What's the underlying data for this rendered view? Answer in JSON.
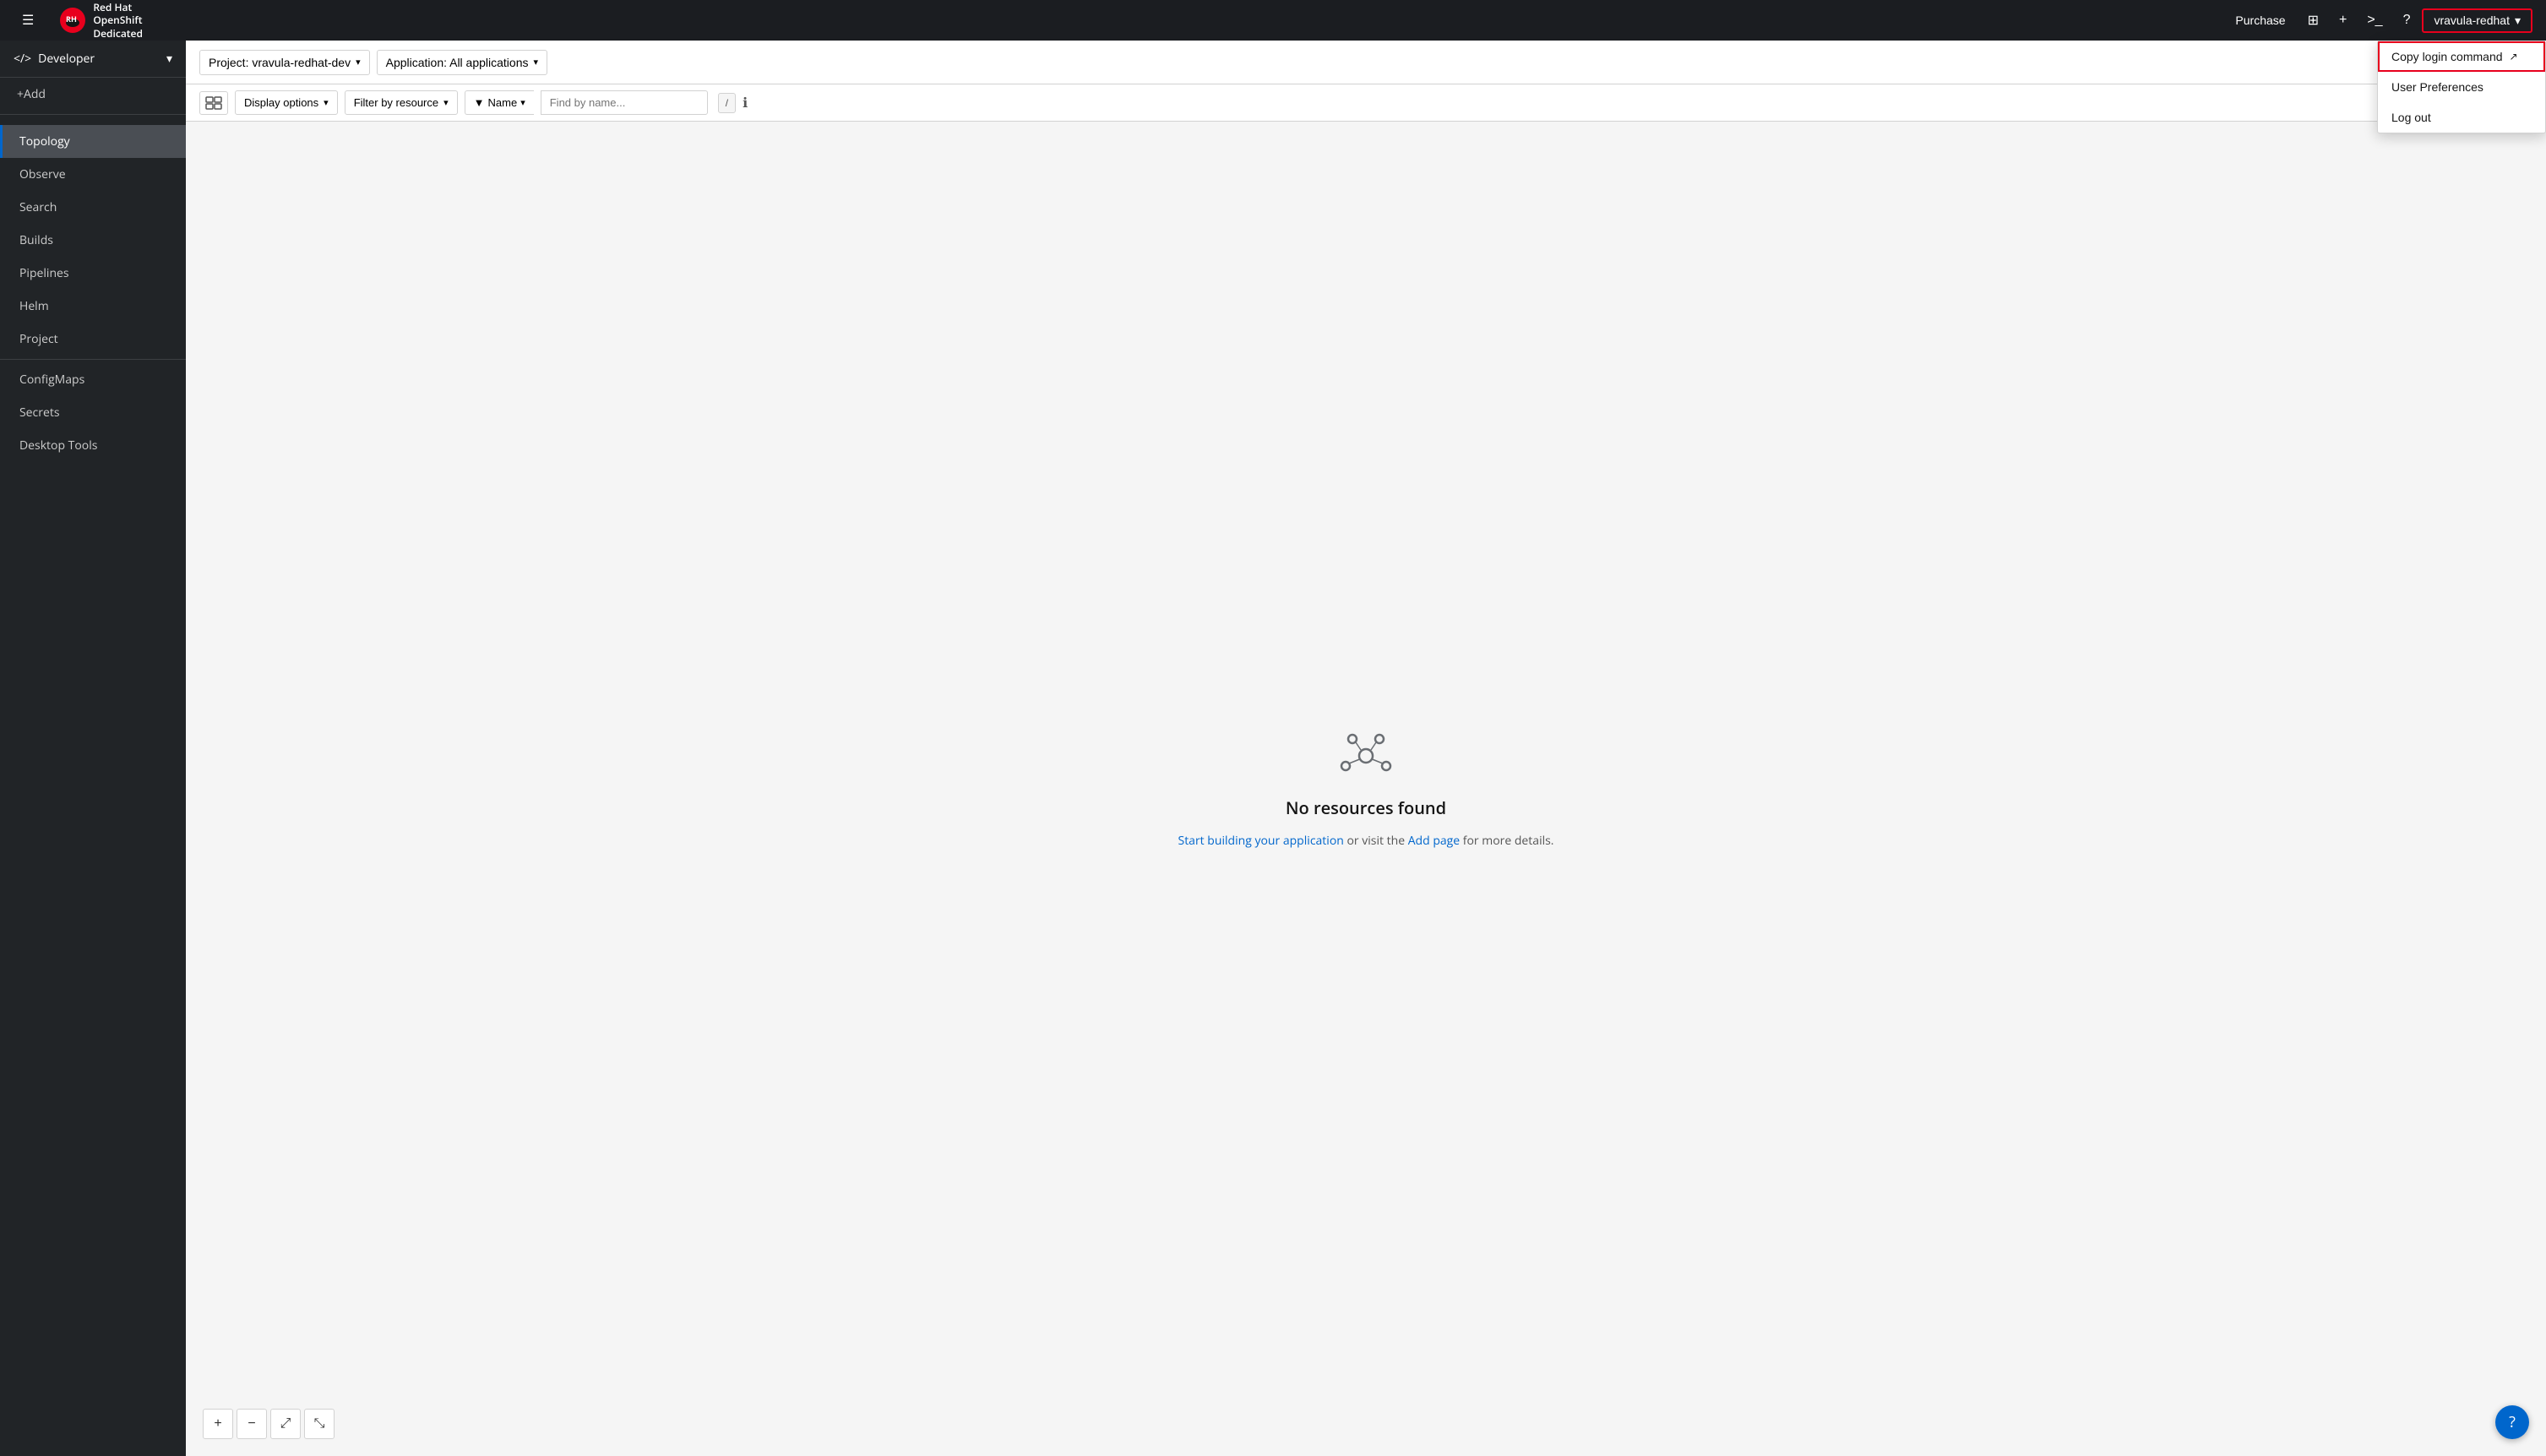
{
  "navbar": {
    "hamburger_label": "☰",
    "brand_line1": "Red Hat",
    "brand_line2": "OpenShift",
    "brand_line3": "Dedicated",
    "purchase_label": "Purchase",
    "grid_icon": "⊞",
    "plus_icon": "+",
    "terminal_icon": ">_",
    "help_icon": "?",
    "user_label": "vravula-redhat",
    "user_chevron": "▾"
  },
  "user_dropdown": {
    "copy_login_label": "Copy login command",
    "copy_login_icon": "↗",
    "user_preferences_label": "User Preferences",
    "logout_label": "Log out"
  },
  "sidebar": {
    "role_label": "Developer",
    "role_chevron": "▾",
    "add_label": "+Add",
    "items": [
      {
        "id": "topology",
        "label": "Topology",
        "active": true
      },
      {
        "id": "observe",
        "label": "Observe"
      },
      {
        "id": "search",
        "label": "Search"
      },
      {
        "id": "builds",
        "label": "Builds"
      },
      {
        "id": "pipelines",
        "label": "Pipelines"
      },
      {
        "id": "helm",
        "label": "Helm"
      },
      {
        "id": "project",
        "label": "Project"
      },
      {
        "id": "configmaps",
        "label": "ConfigMaps"
      },
      {
        "id": "secrets",
        "label": "Secrets"
      },
      {
        "id": "desktop-tools",
        "label": "Desktop Tools"
      }
    ]
  },
  "toolbar": {
    "project_label": "Project: vravula-redhat-dev",
    "project_chevron": "▾",
    "app_label": "Application: All applications",
    "app_chevron": "▾",
    "help_icon": "?",
    "view_icon": "W"
  },
  "filter_toolbar": {
    "view_toggle_icon": "📋",
    "display_options_label": "Display options",
    "display_options_chevron": "▾",
    "filter_resource_label": "Filter by resource",
    "filter_resource_chevron": "▾",
    "filter_icon": "▼",
    "name_label": "Name",
    "name_chevron": "▾",
    "search_placeholder": "Find by name...",
    "slash_label": "/",
    "info_icon": "ℹ"
  },
  "topology": {
    "empty_title": "No resources found",
    "empty_desc_before": "Start building your application",
    "empty_desc_or": " or visit the ",
    "empty_desc_link": "Add page",
    "empty_desc_after": " for more details."
  },
  "zoom": {
    "zoom_in": "+",
    "zoom_out": "−",
    "fit": "⤢",
    "expand": "⤡"
  },
  "help_fab": {
    "icon": "?"
  }
}
